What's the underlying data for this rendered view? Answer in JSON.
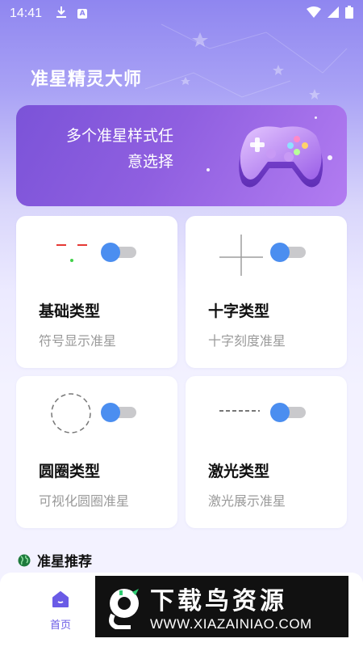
{
  "status_bar": {
    "time": "14:41",
    "icons": [
      "download-icon",
      "a-icon",
      "wifi-icon",
      "signal-icon",
      "battery-icon"
    ],
    "a_badge": "A"
  },
  "app_title": "准星精灵大师",
  "banner": {
    "line1": "多个准星样式任",
    "line2": "意选择",
    "icon": "gamepad-icon"
  },
  "cards": [
    {
      "title": "基础类型",
      "subtitle": "符号显示准星",
      "enabled": true
    },
    {
      "title": "十字类型",
      "subtitle": "十字刻度准星",
      "enabled": true
    },
    {
      "title": "圆圈类型",
      "subtitle": "可视化圆圈准星",
      "enabled": true
    },
    {
      "title": "激光类型",
      "subtitle": "激光展示准星",
      "enabled": true
    }
  ],
  "section": {
    "title": "准星推荐",
    "icon": "globe-icon"
  },
  "nav": {
    "home_label": "首页",
    "home_icon": "home-icon"
  },
  "watermark": {
    "title": "下载鸟资源",
    "url": "WWW.XIAZAINIAO.COM"
  },
  "colors": {
    "accent": "#6a5be6",
    "toggle_knob": "#4b8ef0",
    "toggle_track": "#c9c9cc",
    "banner_start": "#7b53d8",
    "banner_end": "#b27cf1"
  }
}
